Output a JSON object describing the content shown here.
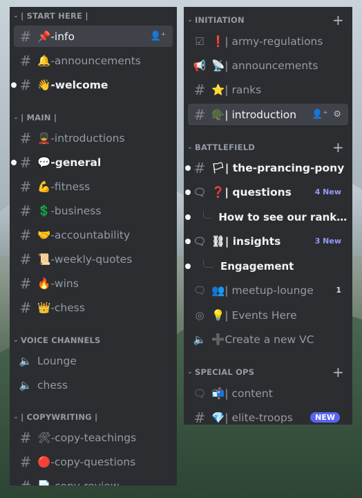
{
  "left_sidebar": {
    "categories": [
      {
        "label": "| START HERE |"
      },
      {
        "label": "| MAIN |"
      },
      {
        "label": "VOICE CHANNELS"
      },
      {
        "label": "| COPYWRITING |"
      }
    ],
    "channels": [
      {
        "emoji": "📌",
        "label": "-info"
      },
      {
        "emoji": "🔔",
        "label": "-announcements"
      },
      {
        "emoji": "👋",
        "label": "-welcome"
      },
      {
        "emoji": "💂",
        "label": "-introductions"
      },
      {
        "emoji": "💬",
        "label": "-general"
      },
      {
        "emoji": "💪",
        "label": "-fitness"
      },
      {
        "emoji": "💲",
        "label": "-business"
      },
      {
        "emoji": "🤝",
        "label": "-accountability"
      },
      {
        "emoji": "📜",
        "label": "-weekly-quotes"
      },
      {
        "emoji": "🔥",
        "label": "-wins"
      },
      {
        "emoji": "👑",
        "label": "-chess"
      },
      {
        "label": "Lounge"
      },
      {
        "label": "chess"
      },
      {
        "emoji": "🛠",
        "label": "-copy-teachings"
      },
      {
        "emoji": "🔴",
        "label": "-copy-questions"
      },
      {
        "emoji": "📄",
        "label": "-copy-review"
      }
    ]
  },
  "right_sidebar": {
    "categories": [
      {
        "label": "INITIATION"
      },
      {
        "label": "BATTLEFIELD"
      },
      {
        "label": "SPECIAL OPS"
      }
    ],
    "channels": [
      {
        "emoji": "❗",
        "label": "| army-regulations"
      },
      {
        "emoji": "📡",
        "label": "| announcements"
      },
      {
        "emoji": "⭐",
        "label": "| ranks"
      },
      {
        "emoji": "🪖",
        "label": "| introduction"
      },
      {
        "emoji": "🏳",
        "label": "| the-prancing-pony"
      },
      {
        "emoji": "❓",
        "label": "| questions",
        "badge": "4 New"
      },
      {
        "label": "How to see our rank in th..."
      },
      {
        "emoji": "⛓",
        "label": "| insights",
        "badge": "3 New"
      },
      {
        "label": "Engagement"
      },
      {
        "emoji": "👥",
        "label": "| meetup-lounge",
        "count": "1"
      },
      {
        "emoji": "💡",
        "label": "| Events Here"
      },
      {
        "emoji": "➕",
        "label": "Create a new VC"
      },
      {
        "emoji": "📬",
        "label": "| content"
      },
      {
        "emoji": "💎",
        "label": "| elite-troops",
        "badge": "NEW"
      }
    ]
  }
}
